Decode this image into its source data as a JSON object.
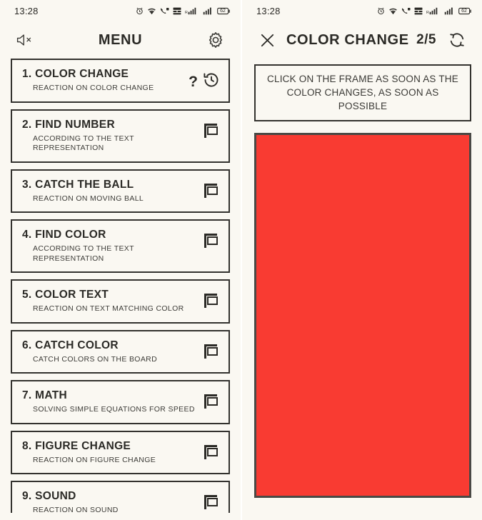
{
  "statusbar": {
    "time": "13:28",
    "battery_level": "62",
    "icons": [
      "alarm-icon",
      "wifi-icon",
      "call-mute-icon",
      "data-saver-icon",
      "signal-roaming-icon",
      "signal-icon",
      "battery-icon"
    ]
  },
  "menu_screen": {
    "title": "MENU",
    "sound_icon": "speaker-mute-icon",
    "settings_icon": "gear-icon",
    "items": [
      {
        "number": "1.",
        "title": "COLOR CHANGE",
        "subtitle": "REACTION ON COLOR CHANGE",
        "help_label": "?",
        "action_icon": "history-icon",
        "locked": false
      },
      {
        "number": "2.",
        "title": "FIND NUMBER",
        "subtitle": "ACCORDING TO THE TEXT REPRESENTATION",
        "action_icon": "ad-billboard-icon",
        "locked": true
      },
      {
        "number": "3.",
        "title": "CATCH THE BALL",
        "subtitle": "REACTION ON MOVING BALL",
        "action_icon": "ad-billboard-icon",
        "locked": true
      },
      {
        "number": "4.",
        "title": "FIND COLOR",
        "subtitle": "ACCORDING TO THE TEXT REPRESENTATION",
        "action_icon": "ad-billboard-icon",
        "locked": true
      },
      {
        "number": "5.",
        "title": "COLOR TEXT",
        "subtitle": "REACTION ON TEXT MATCHING COLOR",
        "action_icon": "ad-billboard-icon",
        "locked": true
      },
      {
        "number": "6.",
        "title": "CATCH COLOR",
        "subtitle": "CATCH COLORS ON THE BOARD",
        "action_icon": "ad-billboard-icon",
        "locked": true
      },
      {
        "number": "7.",
        "title": "MATH",
        "subtitle": "SOLVING SIMPLE EQUATIONS FOR SPEED",
        "action_icon": "ad-billboard-icon",
        "locked": true
      },
      {
        "number": "8.",
        "title": "FIGURE CHANGE",
        "subtitle": "REACTION ON FIGURE CHANGE",
        "action_icon": "ad-billboard-icon",
        "locked": true
      },
      {
        "number": "9.",
        "title": "SOUND",
        "subtitle": "REACTION ON SOUND",
        "action_icon": "ad-billboard-icon",
        "locked": true
      }
    ]
  },
  "game_screen": {
    "close_icon": "close-x-icon",
    "title": "COLOR CHANGE",
    "round_counter": "2/5",
    "restart_icon": "refresh-icon",
    "instruction": "CLICK ON THE FRAME AS SOON AS THE COLOR CHANGES, AS SOON AS POSSIBLE",
    "frame_color": "#f93b32",
    "frame_border_color": "#4a4945"
  },
  "theme": {
    "background": "#faf8f2",
    "ink": "#2b2a26",
    "border": "#33322e"
  }
}
